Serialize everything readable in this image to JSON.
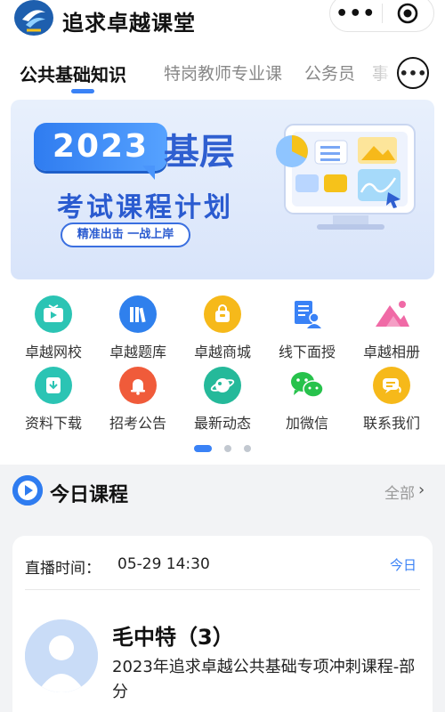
{
  "header": {
    "app_title": "追求卓越课堂",
    "capsule_more": "•••",
    "icons": {
      "logo": "brand-logo",
      "target": "target-icon"
    }
  },
  "tabs": {
    "items": [
      {
        "label": "公共基础知识",
        "active": true
      },
      {
        "label": "特岗教师专业课",
        "active": false
      },
      {
        "label": "公务员",
        "active": false
      },
      {
        "label": "事",
        "active": false
      }
    ],
    "more": "•••"
  },
  "banner": {
    "year": "2023",
    "word": "基层",
    "subtitle": "考试课程计划",
    "slogan": "精准出击 一战上岸",
    "current_slide": 2,
    "total_slides": 3
  },
  "grid": {
    "items": [
      {
        "label": "卓越网校",
        "icon": "play-tv-icon",
        "color": "#2bc4b4"
      },
      {
        "label": "卓越题库",
        "icon": "books-icon",
        "color": "#2f80ed"
      },
      {
        "label": "卓越商城",
        "icon": "shopping-bag-icon",
        "color": "#f6b91a"
      },
      {
        "label": "线下面授",
        "icon": "teacher-board-icon",
        "color": "#3a82f6"
      },
      {
        "label": "卓越相册",
        "icon": "photo-album-icon",
        "color": "#f06aa6"
      },
      {
        "label": "资料下载",
        "icon": "download-icon",
        "color": "#2bc4b4"
      },
      {
        "label": "招考公告",
        "icon": "bell-icon",
        "color": "#f05b3a"
      },
      {
        "label": "最新动态",
        "icon": "planet-icon",
        "color": "#25b99a"
      },
      {
        "label": "加微信",
        "icon": "wechat-icon",
        "color": "#27c24c"
      },
      {
        "label": "联系我们",
        "icon": "chat-contact-icon",
        "color": "#f6b91a"
      }
    ],
    "current_page": 1,
    "total_pages": 3
  },
  "section": {
    "title": "今日课程",
    "all_label": "全部",
    "chevron": "›"
  },
  "course": {
    "live_label": "直播时间：",
    "live_time": "05-29 14:30",
    "today": "今日",
    "teacher": "毛中特（3）",
    "title": "2023年追求卓越公共基础专项冲刺课程-部分"
  }
}
